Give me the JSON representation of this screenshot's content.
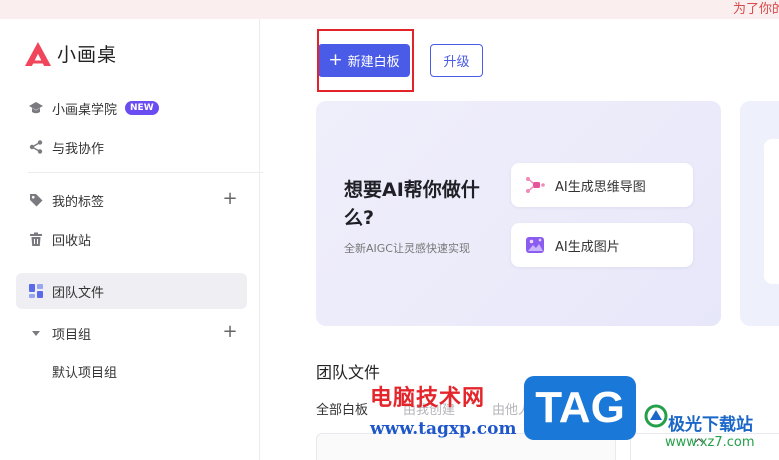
{
  "banner": {
    "text": "为了你的"
  },
  "app": {
    "name": "小画桌"
  },
  "sidebar": {
    "academy": {
      "label": "小画桌学院",
      "badge": "NEW"
    },
    "collab": {
      "label": "与我协作"
    },
    "tags": {
      "label": "我的标签",
      "add": "+"
    },
    "trash": {
      "label": "回收站"
    },
    "team_files": {
      "label": "团队文件"
    },
    "project_group": {
      "label": "项目组",
      "add": "+"
    },
    "default_group": {
      "label": "默认项目组"
    }
  },
  "toolbar": {
    "new_label": "新建白板",
    "new_plus": "+",
    "upgrade_label": "升级"
  },
  "ai_card": {
    "title": "想要AI帮你做什么?",
    "subtitle": "全新AIGC让灵感快速实现",
    "mindmap_label": "AI生成思维导图",
    "image_label": "AI生成图片"
  },
  "main": {
    "section_title": "团队文件",
    "tabs": [
      "全部白板",
      "由我创建",
      "由他人创建"
    ],
    "caret": "^"
  },
  "watermark": {
    "cn": "电脑技术网",
    "url": "www.tagxp.com",
    "tag": "TAG",
    "site": "极光下载站",
    "site_url": "www.xz7.com"
  },
  "colors": {
    "primary": "#4a5be8",
    "badge": "#6a4cf2",
    "highlight": "#e3232a",
    "banner_text": "#d94a4a"
  }
}
